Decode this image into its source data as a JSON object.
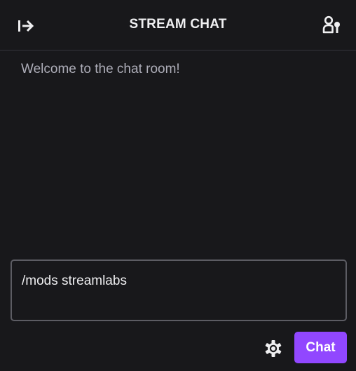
{
  "header": {
    "title": "STREAM CHAT",
    "collapse_icon": "arrow-collapse-right-icon",
    "community_icon": "community-users-icon"
  },
  "messages": {
    "welcome": "Welcome to the chat room!"
  },
  "composer": {
    "value": "/mods streamlabs",
    "settings_icon": "gear-icon",
    "send_label": "Chat"
  },
  "colors": {
    "background": "#18181b",
    "text": "#efeff1",
    "muted_text": "#adadb8",
    "accent": "#9147ff",
    "border": "#5c5c63"
  }
}
